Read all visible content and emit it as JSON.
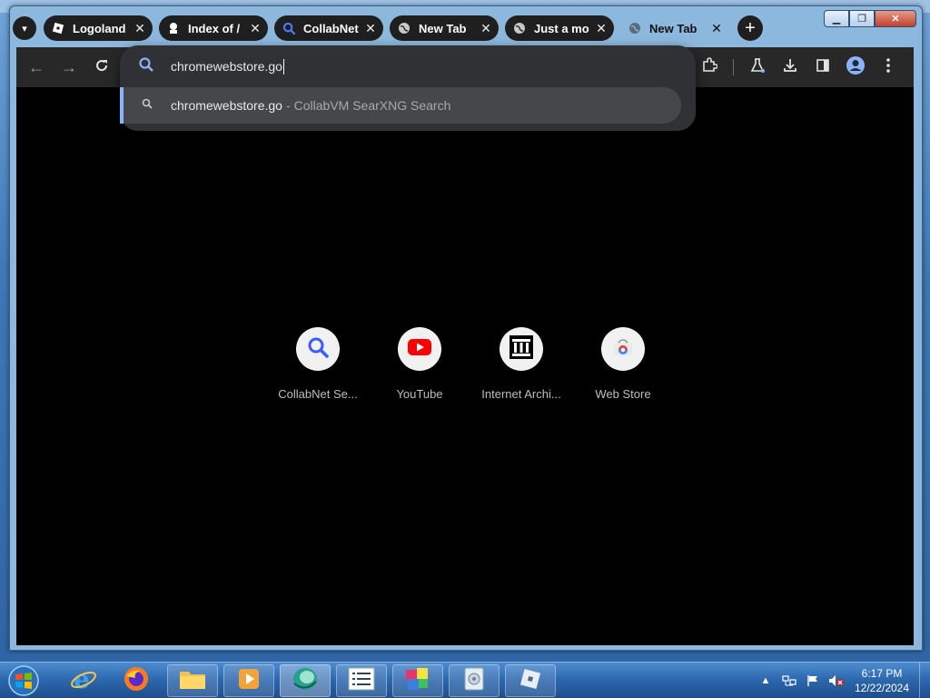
{
  "tabs": [
    {
      "title": "Logoland",
      "favicon": "roblox-icon"
    },
    {
      "title": "Index of /",
      "favicon": "archive-icon"
    },
    {
      "title": "CollabNet",
      "favicon": "search-icon"
    },
    {
      "title": "New Tab",
      "favicon": "globe-icon"
    },
    {
      "title": "Just a mo",
      "favicon": "globe-icon"
    },
    {
      "title": "New Tab",
      "favicon": "globe-icon",
      "active": true
    }
  ],
  "omnibox": {
    "typed": "chromewebstore.go",
    "suggestion": {
      "query": "chromewebstore.go",
      "separator": "-",
      "engine": "CollabVM SearXNG Search"
    }
  },
  "shortcuts": [
    {
      "label": "CollabNet Se...",
      "icon": "search-icon"
    },
    {
      "label": "YouTube",
      "icon": "youtube-icon"
    },
    {
      "label": "Internet Archi...",
      "icon": "archive-icon"
    },
    {
      "label": "Web Store",
      "icon": "web-store-icon"
    }
  ],
  "taskbar": {
    "time": "6:17 PM",
    "date": "12/22/2024"
  },
  "colors": {
    "toolbar": "#282828",
    "omnibox": "#303134",
    "suggestion_highlight": "#8ab4f8",
    "page_background": "#000000"
  }
}
